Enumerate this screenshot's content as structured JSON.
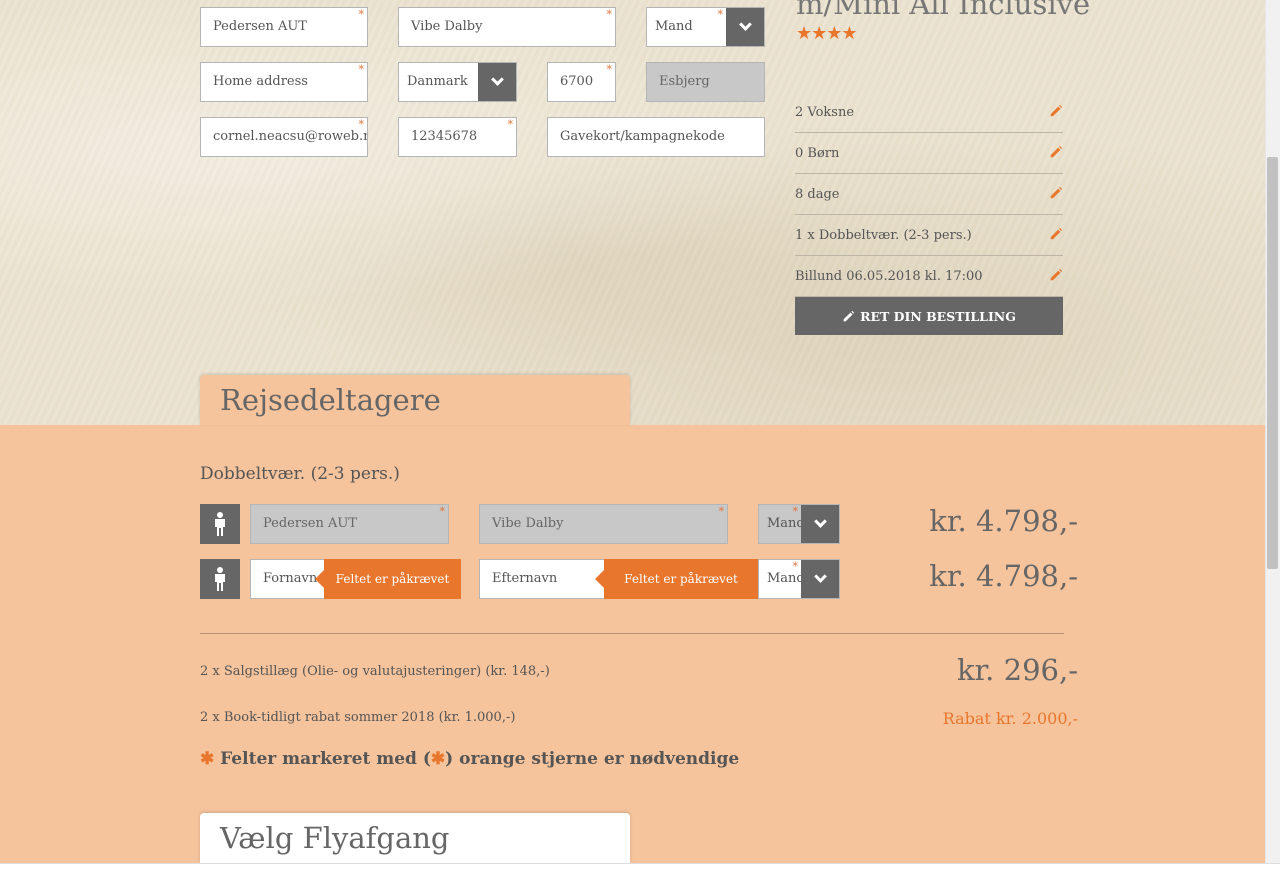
{
  "contact_form": {
    "first_name": "Pedersen AUT",
    "last_name": "Vibe Dalby",
    "gender": "Mand",
    "address": "Home address",
    "country": "Danmark",
    "zip": "6700",
    "city": "Esbjerg",
    "email": "cornel.neacsu@roweb.ro",
    "phone": "12345678",
    "giftcard_placeholder": "Gavekort/kampagnekode",
    "required_mark": "*"
  },
  "hotel": {
    "title": "m/Mini All Inclusive",
    "stars_text": "★★★★",
    "star_count": 4
  },
  "summary": {
    "rows": [
      "2 Voksne",
      "0 Børn",
      "8 dage",
      "1 x Dobbeltvær. (2-3 pers.)",
      "Billund 06.05.2018 kl. 17:00"
    ],
    "edit_button": "RET DIN BESTILLING"
  },
  "travelers": {
    "tab_title": "Rejsedeltagere",
    "room_title": "Dobbeltvær. (2-3 pers.)",
    "rows": [
      {
        "first": "Pedersen AUT",
        "last": "Vibe Dalby",
        "gender": "Mand",
        "price": "kr. 4.798,-"
      },
      {
        "first": "Fornavn",
        "last": "Efternavn",
        "gender": "Mand",
        "price": "kr. 4.798,-",
        "first_error": "Feltet er påkrævet",
        "last_error": "Feltet er påkrævet"
      }
    ],
    "fees": [
      {
        "label": "2 x Salgstillæg (Olie- og valutajusteringer) (kr. 148,-)",
        "amount": "kr. 296,-"
      },
      {
        "label": "2 x Book-tidligt rabat sommer 2018 (kr. 1.000,-)",
        "amount": "Rabat kr. 2.000,-"
      }
    ],
    "note_prefix": "Felter markeret med (",
    "note_suffix": ") orange stjerne er nødvendige",
    "note_star": "✱"
  },
  "flight": {
    "tab_title": "Vælg Flyafgang"
  },
  "colors": {
    "accent": "#e8762d",
    "dark_button": "#666666",
    "sand_bg": "#ebe3d0",
    "peach_bg": "#f5c39c"
  }
}
